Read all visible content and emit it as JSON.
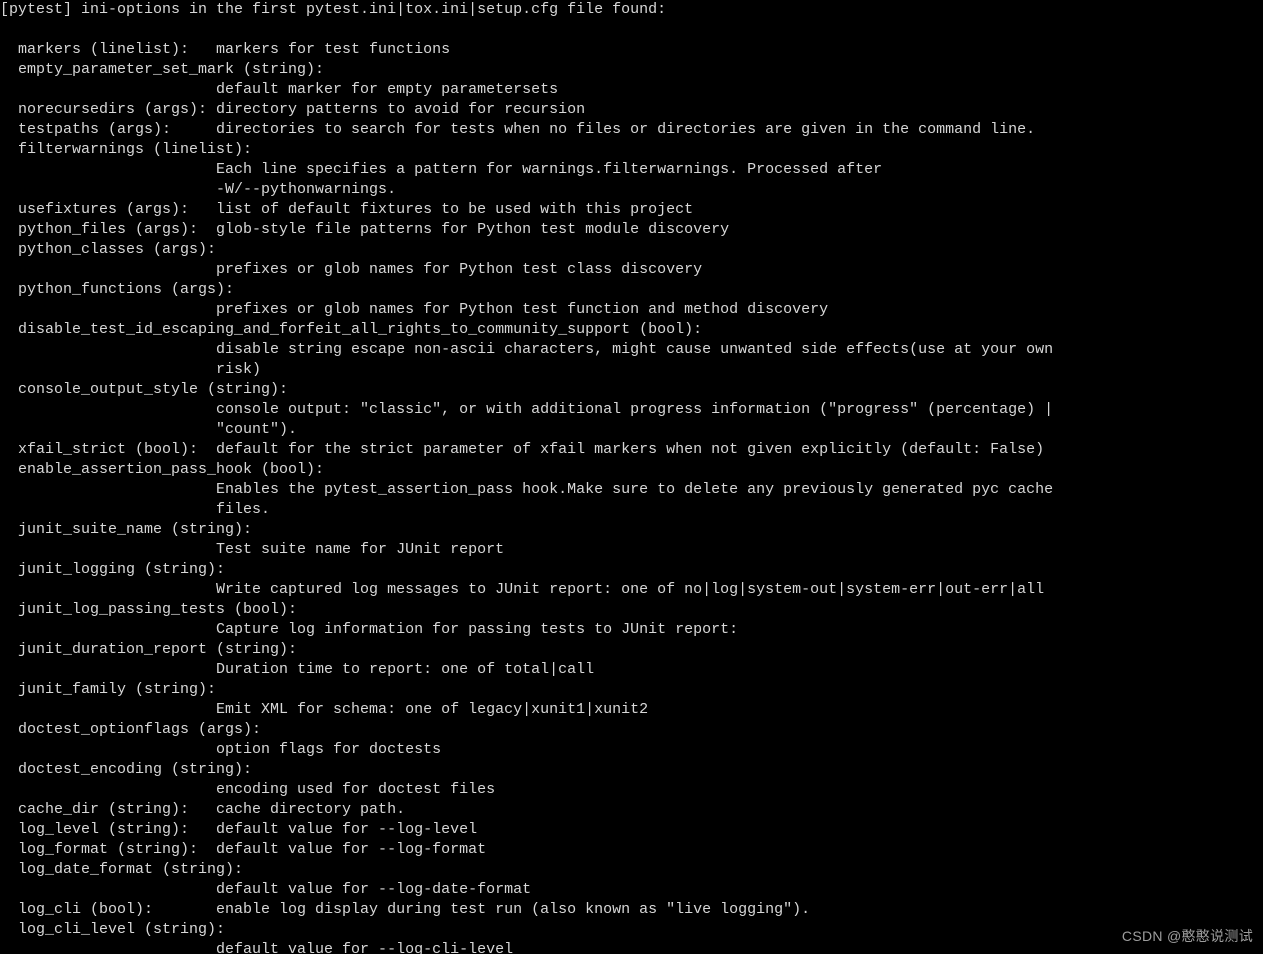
{
  "watermark": "CSDN @憨憨说测试",
  "header": "[pytest] ini-options in the first pytest.ini|tox.ini|setup.cfg file found:",
  "options": [
    {
      "name": "markers",
      "type": "linelist",
      "inline": true,
      "desc": "markers for test functions"
    },
    {
      "name": "empty_parameter_set_mark",
      "type": "string",
      "inline": false,
      "desc": "default marker for empty parametersets"
    },
    {
      "name": "norecursedirs",
      "type": "args",
      "inline": true,
      "desc": "directory patterns to avoid for recursion"
    },
    {
      "name": "testpaths",
      "type": "args",
      "inline": true,
      "desc": "directories to search for tests when no files or directories are given in the command line."
    },
    {
      "name": "filterwarnings",
      "type": "linelist",
      "inline": false,
      "desc": "Each line specifies a pattern for warnings.filterwarnings. Processed after -W/--pythonwarnings."
    },
    {
      "name": "usefixtures",
      "type": "args",
      "inline": true,
      "desc": "list of default fixtures to be used with this project"
    },
    {
      "name": "python_files",
      "type": "args",
      "inline": true,
      "desc": "glob-style file patterns for Python test module discovery"
    },
    {
      "name": "python_classes",
      "type": "args",
      "inline": false,
      "desc": "prefixes or glob names for Python test class discovery"
    },
    {
      "name": "python_functions",
      "type": "args",
      "inline": false,
      "desc": "prefixes or glob names for Python test function and method discovery"
    },
    {
      "name": "disable_test_id_escaping_and_forfeit_all_rights_to_community_support",
      "type": "bool",
      "inline": false,
      "desc": "disable string escape non-ascii characters, might cause unwanted side effects(use at your own risk)"
    },
    {
      "name": "console_output_style",
      "type": "string",
      "inline": false,
      "desc": "console output: \"classic\", or with additional progress information (\"progress\" (percentage) | \"count\")."
    },
    {
      "name": "xfail_strict",
      "type": "bool",
      "inline": true,
      "desc": "default for the strict parameter of xfail markers when not given explicitly (default: False)"
    },
    {
      "name": "enable_assertion_pass_hook",
      "type": "bool",
      "inline": false,
      "desc": "Enables the pytest_assertion_pass hook.Make sure to delete any previously generated pyc cache files."
    },
    {
      "name": "junit_suite_name",
      "type": "string",
      "inline": false,
      "desc": "Test suite name for JUnit report"
    },
    {
      "name": "junit_logging",
      "type": "string",
      "inline": false,
      "desc": "Write captured log messages to JUnit report: one of no|log|system-out|system-err|out-err|all"
    },
    {
      "name": "junit_log_passing_tests",
      "type": "bool",
      "inline": false,
      "desc": "Capture log information for passing tests to JUnit report:"
    },
    {
      "name": "junit_duration_report",
      "type": "string",
      "inline": false,
      "desc": "Duration time to report: one of total|call"
    },
    {
      "name": "junit_family",
      "type": "string",
      "inline": false,
      "desc": "Emit XML for schema: one of legacy|xunit1|xunit2"
    },
    {
      "name": "doctest_optionflags",
      "type": "args",
      "inline": false,
      "desc": "option flags for doctests"
    },
    {
      "name": "doctest_encoding",
      "type": "string",
      "inline": false,
      "desc": "encoding used for doctest files"
    },
    {
      "name": "cache_dir",
      "type": "string",
      "inline": true,
      "desc": "cache directory path."
    },
    {
      "name": "log_level",
      "type": "string",
      "inline": true,
      "desc": "default value for --log-level"
    },
    {
      "name": "log_format",
      "type": "string",
      "inline": true,
      "desc": "default value for --log-format"
    },
    {
      "name": "log_date_format",
      "type": "string",
      "inline": false,
      "desc": "default value for --log-date-format"
    },
    {
      "name": "log_cli",
      "type": "bool",
      "inline": true,
      "desc": "enable log display during test run (also known as \"live logging\")."
    },
    {
      "name": "log_cli_level",
      "type": "string",
      "inline": false,
      "desc": "default value for --log-cli-level"
    }
  ]
}
